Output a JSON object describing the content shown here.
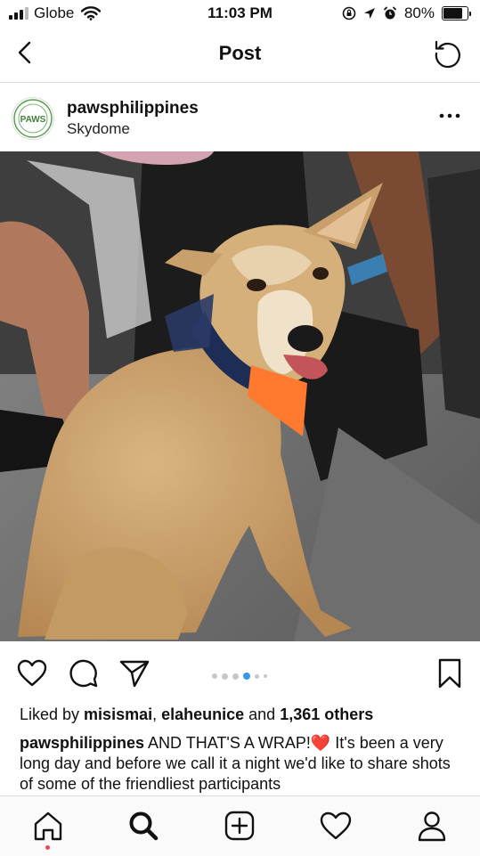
{
  "status_bar": {
    "carrier": "Globe",
    "time": "11:03 PM",
    "battery": "80%",
    "battery_level": 0.8,
    "signal_bars": 3
  },
  "header": {
    "title": "Post"
  },
  "post": {
    "username": "pawsphilippines",
    "location": "Skydome",
    "avatar_text": "PAWS",
    "carousel": {
      "count": 6,
      "active_index": 3
    },
    "likes": {
      "prefix": "Liked by ",
      "users": [
        "misismai",
        "elaheunice"
      ],
      "separator": ", ",
      "conjunction": " and ",
      "count": "1,361 others"
    },
    "caption": {
      "username": "pawsphilippines",
      "text": " AND THAT'S A WRAP!",
      "emoji": "❤️",
      "rest": " It's been a very long day and before we call it a night we'd like to share shots of some of the friendliest participants"
    }
  },
  "icons": {
    "back": "chevron-left-icon",
    "refresh": "refresh-icon",
    "more": "more-options-icon",
    "like": "heart-icon",
    "comment": "comment-icon",
    "share": "send-icon",
    "save": "bookmark-icon",
    "home": "home-icon",
    "search": "search-icon",
    "new_post": "plus-square-icon",
    "activity": "heart-icon",
    "profile": "profile-icon"
  },
  "colors": {
    "accent_blue": "#3897f0",
    "heart_red": "#ed4956",
    "divider": "#dbdbdb"
  }
}
